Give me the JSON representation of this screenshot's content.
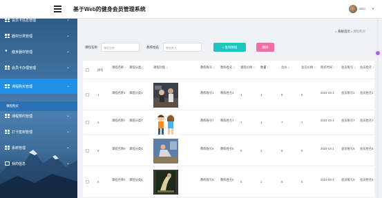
{
  "header": {
    "title": "基于Web的健身会员管理系统",
    "user": "abcc",
    "caret": "▼"
  },
  "sidebar": {
    "items": [
      {
        "label": "会员卡信息管理",
        "icon": "grid-icon"
      },
      {
        "label": "器材分类管理",
        "icon": "grid-icon"
      },
      {
        "label": "健身器材管理",
        "icon": "bulb-icon"
      },
      {
        "label": "会员卡办理管理",
        "icon": "grid-icon"
      },
      {
        "label": "课程购买管理",
        "icon": "grid-icon",
        "active": true
      },
      {
        "label": "课程预约管理",
        "icon": "grid-icon"
      },
      {
        "label": "打卡签到管理",
        "icon": "grid-icon"
      },
      {
        "label": "系统管理",
        "icon": "grid-icon"
      },
      {
        "label": "我的信息",
        "icon": "calendar-icon"
      }
    ],
    "submenu": "课程购买",
    "chevron": "⌄"
  },
  "breadcrumb": {
    "home": "系统首页",
    "sep": "›",
    "current": "课程购买"
  },
  "search": {
    "label_course": "课程名称",
    "placeholder_course": "课程名称",
    "label_coach": "教练姓名",
    "placeholder_coach": "教练姓名",
    "search_btn": "查询数据",
    "delete_btn": "删除"
  },
  "table": {
    "headers": [
      "序号",
      "课程名称",
      "课程分类",
      "课程封面",
      "教练账号",
      "教练姓名",
      "课程价格",
      "数量",
      "总价",
      "会员价格",
      "购买时间",
      "会员账号",
      "会员姓名"
    ],
    "sort_glyph": "⇕",
    "rows": [
      {
        "index": "1",
        "name": "课程名称1",
        "category": "课程分类1",
        "coach_acc": "教练账号1",
        "coach_name": "教练姓名1",
        "price": "1",
        "qty": "1",
        "total": "8",
        "member_price": "8",
        "time": "2024-03-1",
        "member_acc": "会员账号1",
        "member_name": "会员姓名1",
        "thumb": "gym"
      },
      {
        "index": "2",
        "name": "课程名称7",
        "category": "课程分类7",
        "coach_acc": "教练账号7",
        "coach_name": "教练姓名7",
        "price": "7",
        "qty": "1",
        "total": "7",
        "member_price": "7",
        "time": "2024-03-1",
        "member_acc": "会员账号7",
        "member_name": "会员姓名7",
        "thumb": "couple"
      },
      {
        "index": "3",
        "name": "课程名称6",
        "category": "课程分类6",
        "coach_acc": "教练账号6",
        "coach_name": "教练姓名6",
        "price": "6",
        "qty": "1",
        "total": "6",
        "member_price": "6",
        "time": "2024-03-1",
        "member_acc": "会员账号6",
        "member_name": "会员姓名6",
        "thumb": "yoga"
      },
      {
        "index": "4",
        "name": "课程名称5",
        "category": "课程分类5",
        "coach_acc": "教练账号5",
        "coach_name": "教练姓名5",
        "price": "5",
        "qty": "1",
        "total": "5",
        "member_price": "5",
        "time": "2024-03-1",
        "member_acc": "会员账号5",
        "member_name": "会员姓名5",
        "thumb": "stretch"
      }
    ]
  },
  "colors": {
    "accent": "#20c4bf",
    "danger": "#f56ca7",
    "menu_active": "#1e90e6"
  }
}
